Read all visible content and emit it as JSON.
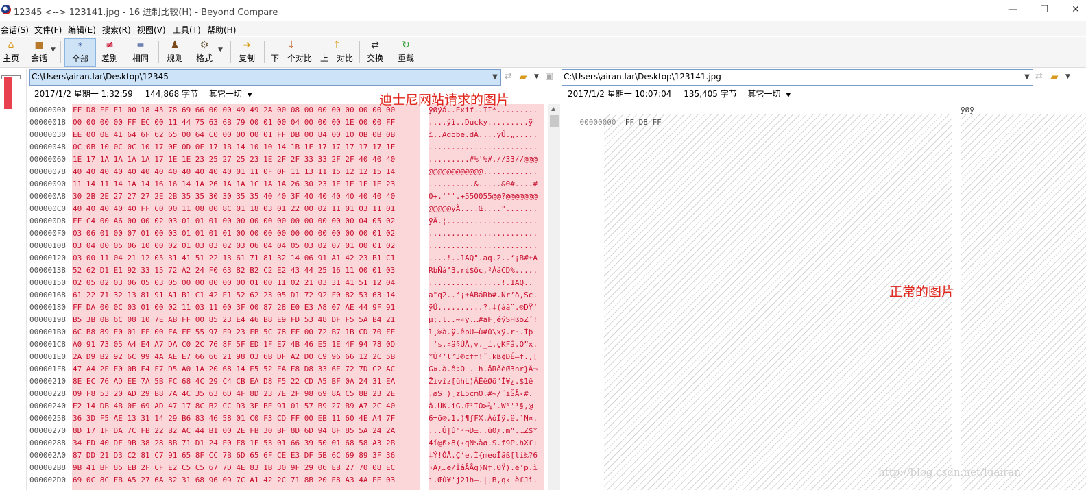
{
  "window": {
    "title": "12345 <--> 123141.jpg - 16 进制比较(H) - Beyond Compare",
    "minimize": "—",
    "maximize": "☐",
    "close": "✕"
  },
  "menu": [
    "会话(S)",
    "文件(F)",
    "编辑(E)",
    "搜索(R)",
    "视图(V)",
    "工具(T)",
    "帮助(H)"
  ],
  "toolbar": {
    "home": "主页",
    "session": "会话",
    "all": "全部",
    "diffs": "差别",
    "same": "相同",
    "rules": "规则",
    "format": "格式",
    "copy": "复制",
    "next_diff": "下一个对比",
    "prev_diff": "上一对比",
    "swap": "交换",
    "reload": "重载"
  },
  "left": {
    "path": "C:\\Users\\airan.lar\\Desktop\\12345",
    "date": "2017/1/2 星期一 1:32:59",
    "size": "144,868 字节",
    "other": "其它一切",
    "rows": [
      {
        "a": "00000000",
        "h": "FF D8 FF E1 00 18 45 78 69 66 00 00 49 49 2A 00 08 00 00 00 00 00 00 00",
        "t": "ÿØÿá..Exif..II*........."
      },
      {
        "a": "00000018",
        "h": "00 00 00 00 FF EC 00 11 44 75 63 6B 79 00 01 00 04 00 00 00 1E 00 00 FF",
        "t": "....ÿì..Ducky.........ÿ"
      },
      {
        "a": "00000030",
        "h": "EE 00 0E 41 64 6F 62 65 00 64 C0 00 00 00 01 FF DB 00 84 00 10 0B 0B 0B",
        "t": "î..Adobe.dÀ....ÿÛ.„....."
      },
      {
        "a": "00000048",
        "h": "0C 0B 10 0C 0C 10 17 0F 0D 0F 17 1B 14 10 10 14 1B 1F 17 17 17 17 17 1F",
        "t": "........................"
      },
      {
        "a": "00000060",
        "h": "1E 17 1A 1A 1A 1A 17 1E 1E 23 25 27 25 23 1E 2F 2F 33 33 2F 2F 40 40 40",
        "t": ".........#%'%#.//33//@@@"
      },
      {
        "a": "00000078",
        "h": "40 40 40 40 40 40 40 40 40 40 40 40 01 11 0F 0F 11 13 11 15 12 12 15 14",
        "t": "@@@@@@@@@@@@............"
      },
      {
        "a": "00000090",
        "h": "11 14 11 14 1A 14 16 16 14 1A 26 1A 1A 1C 1A 1A 26 30 23 1E 1E 1E 1E 23",
        "t": "..........&.....&0#....#"
      },
      {
        "a": "000000A8",
        "h": "30 2B 2E 27 27 27 2E 2B 35 35 30 30 35 35 40 40 3F 40 40 40 40 40 40 40",
        "t": "0+.'''.+550055@@?@@@@@@@"
      },
      {
        "a": "000000C0",
        "h": "40 40 40 40 40 FF C0 00 11 08 00 8C 01 18 03 01 22 00 02 11 01 03 11 01",
        "t": "@@@@@ÿÀ....Œ....\"......."
      },
      {
        "a": "000000D8",
        "h": "FF C4 00 A6 00 00 02 03 01 01 01 00 00 00 00 00 00 00 00 00 00 04 05 02",
        "t": "ÿÄ.¦...................."
      },
      {
        "a": "000000F0",
        "h": "03 06 01 00 07 01 00 03 01 01 01 01 00 00 00 00 00 00 00 00 00 00 01 02",
        "t": "........................"
      },
      {
        "a": "00000108",
        "h": "03 04 00 05 06 10 00 02 01 03 03 02 03 06 04 04 05 03 02 07 01 00 01 02",
        "t": "........................"
      },
      {
        "a": "00000120",
        "h": "03 00 11 04 21 12 05 31 41 51 22 13 61 71 81 32 14 06 91 A1 42 23 B1 C1",
        "t": "....!..1AQ\".aq.2..‘¡B#±Á"
      },
      {
        "a": "00000138",
        "h": "52 62 D1 E1 92 33 15 72 A2 24 F0 63 82 B2 C2 E2 43 44 25 16 11 00 01 03",
        "t": "RbÑá’3.r¢$ðc‚²ÂâCD%....."
      },
      {
        "a": "00000150",
        "h": "02 05 02 03 06 05 03 05 00 00 00 00 00 01 00 11 02 21 03 31 41 51 12 04",
        "t": "................!.1AQ.."
      },
      {
        "a": "00000168",
        "h": "61 22 71 32 13 81 91 A1 B1 C1 42 E1 52 62 23 05 D1 72 92 F0 82 53 63 14",
        "t": "a\"q2..‘¡±ÁBáRb#.Ñr’ð‚Sc."
      },
      {
        "a": "00000180",
        "h": "FF DA 00 0C 03 01 00 02 11 03 11 00 3F 00 87 28 E0 E3 A8 07 AE 44 9F 91",
        "t": "ÿÚ..........?.‡(àã¨.®DŸ‘"
      },
      {
        "a": "00000198",
        "h": "B5 3B 0B 6C 08 10 7E AB FF 00 85 23 E4 46 B8 E9 FD 53 48 DF F5 5A B4 21",
        "t": "µ;.l..~«ÿ.…#äF¸éýSHßõZ´!"
      },
      {
        "a": "000001B0",
        "h": "6C B8 89 E0 01 FF 00 EA FE 55 97 F9 23 FB 5C 78 FF 00 72 B7 1B CD 70 FE",
        "t": "l¸‰à.ÿ.êþU—ù#û\\xÿ.r·.Íþ"
      },
      {
        "a": "000001C8",
        "h": "A0 91 73 05 A4 E4 A7 DA C0 2C 76 8F 5F ED 1F E7 4B 46 E5 1E 4F 94 78 0D",
        "t": " ‘s.¤ä§ÚÀ,v._í.çKFå.O”x."
      },
      {
        "a": "000001E0",
        "h": "2A D9 B2 92 6C 99 4A AE E7 66 66 21 98 03 6B DF A2 D0 C9 96 66 12 2C 5B",
        "t": "*Ù²’l™J®çff!˜.kß¢ÐÉ–f.,["
      },
      {
        "a": "000001F8",
        "h": "47 A4 2E E0 0B F4 F7 D5 A0 1A 20 68 14 E5 52 EA E8 D8 33 6E 72 7D C2 AC",
        "t": "G¤.à.ô÷Õ . h.åRêèØ3nr}Â¬"
      },
      {
        "a": "00000210",
        "h": "8E EC 76 AD EE 7A 5B FC 68 4C 29 C4 CB EA D8 F5 22 CD A5 BF 0A 24 31 EA",
        "t": "Žìv­îz[ühL)ÄËêØõ\"Í¥¿.$1ê"
      },
      {
        "a": "00000228",
        "h": "09 F8 53 20 AD 29 B8 7A 4C 35 63 6D 4F 8D 23 7E 2F 98 69 8A C5 8B 23 2E",
        "t": ".øS ­)¸zL5cmO.#~/˜iŠÅ‹#."
      },
      {
        "a": "00000240",
        "h": "E2 14 DB 4B 0F 69 AD 47 17 8C B2 CC D3 3E BE 91 01 57 B9 27 B9 A7 2C 40",
        "t": "â.ÛK.i­G.Œ²ÌÓ>¾‘.W¹'¹§,@"
      },
      {
        "a": "00000258",
        "h": "36 3D F5 AE 13 31 14 29 B6 83 46 58 01 C0 F3 CD FF 00 EB 11 60 4E A4 7F",
        "t": "6=õ®.1.)¶ƒFX.ÀóÍÿ.ë.`N¤."
      },
      {
        "a": "00000270",
        "h": "8D 17 1F DA 7C FB 22 B2 AC 44 B1 00 2E FB 30 BF 8D 6D 94 8F 85 5A 24 2A",
        "t": "...Ú|û\"²¬D±..û0¿.m”.…Z$*"
      },
      {
        "a": "00000288",
        "h": "34 ED 40 DF 9B 38 28 8B 71 D1 24 E0 F8 1E 53 01 66 39 50 01 68 58 A3 2B",
        "t": "4í@ß›8(‹qÑ$àø.S.f9P.hX£+"
      },
      {
        "a": "000002A0",
        "h": "87 DD 21 D3 C2 81 C7 91 65 8F CC 7B 6D 65 6F CE E3 DF 5B 6C 69 89 3F 36",
        "t": "‡Ý!ÓÂ.Ç‘e.Ì{meoÎãß[li‰?6"
      },
      {
        "a": "000002B8",
        "h": "9B 41 BF 85 EB 2F CF E2 C5 C5 67 7D 4E 83 1B 30 9F 29 06 EB 27 70 08 EC",
        "t": "›A¿…ë/ÏâÅÅg}Nƒ.0Ÿ).ë'p.ì"
      },
      {
        "a": "000002D0",
        "h": "69 0C 8C FB A5 27 6A 32 31 68 96 09 7C A1 42 2C 71 8B 20 E8 A3 4A EE 03",
        "t": "i.Œû¥'j21h–.|¡B,q‹ è£Jî."
      }
    ]
  },
  "right": {
    "path": "C:\\Users\\airan.lar\\Desktop\\123141.jpg",
    "date": "2017/1/2 星期一 10:07:04",
    "size": "135,405 字节",
    "other": "其它一切",
    "row0": {
      "a": "00000000",
      "h": "FF D8 FF",
      "t": "ÿØÿ"
    }
  },
  "annotations": {
    "left": "迪士尼网站请求的图片",
    "right": "正常的图片"
  },
  "watermark": "http://blog.csdn.net/luairan",
  "colors": {
    "diff_text": "#c8102e",
    "diff_bg": "#fcd7da",
    "annotation": "#e0281e",
    "selection": "#cde3f8"
  }
}
